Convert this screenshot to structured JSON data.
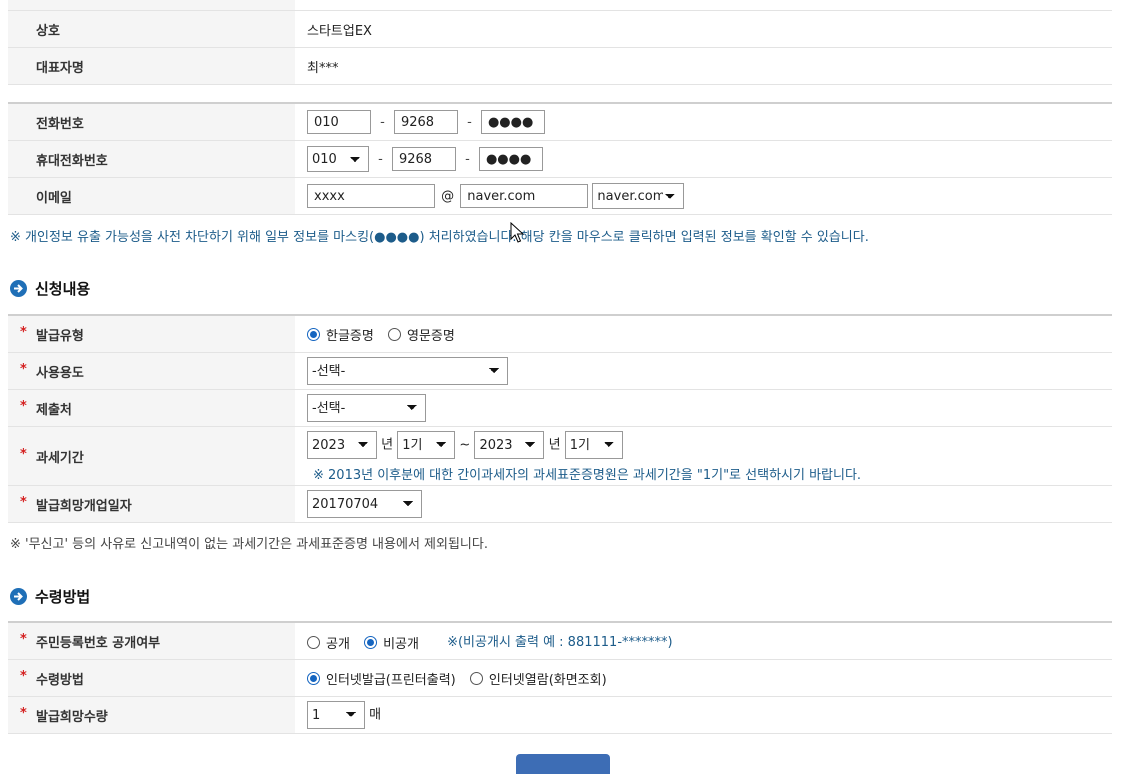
{
  "company": {
    "label": "상호",
    "value": "스타트업EX"
  },
  "ceo": {
    "label": "대표자명",
    "value": "최***"
  },
  "phone": {
    "label": "전화번호",
    "part1": "010",
    "part2": "9268",
    "part3": "●●●●"
  },
  "mobile": {
    "label": "휴대전화번호",
    "part1": "010",
    "part2": "9268",
    "part3": "●●●●"
  },
  "email": {
    "label": "이메일",
    "id": "xxxx",
    "at": "@",
    "domain": "naver.com",
    "domain_select": "naver.com"
  },
  "masking_notice": "※ 개인정보 유출 가능성을 사전 차단하기 위해 일부 정보를 마스킹(●●●●) 처리하였습니다. 해당 칸을 마우스로 클릭하면 입력된 정보를 확인할 수 있습니다.",
  "application": {
    "title": "신청내용",
    "required_mark": "*",
    "issue_type": {
      "label": "발급유형",
      "opt1": "한글증명",
      "opt2": "영문증명"
    },
    "usage": {
      "label": "사용용도",
      "value": "-선택-"
    },
    "submit_to": {
      "label": "제출처",
      "value": "-선택-"
    },
    "tax_period": {
      "label": "과세기간",
      "from_year": "2023",
      "year_unit": "년",
      "from_term": "1기",
      "tilde": "~",
      "to_year": "2023",
      "to_term": "1기",
      "note": "※ 2013년 이후분에 대한 간이과세자의 과세표준증명원은 과세기간을 \"1기\"로 선택하시기 바랍니다."
    },
    "start_date": {
      "label": "발급희망개업일자",
      "value": "20170704"
    }
  },
  "nonfiling_notice": "※ '무신고' 등의 사유로 신고내역이 없는 과세기간은 과세표준증명 내용에서 제외됩니다.",
  "receipt": {
    "title": "수령방법",
    "required_mark": "*",
    "rrn_disclosure": {
      "label": "주민등록번호 공개여부",
      "opt1": "공개",
      "opt2": "비공개",
      "hint": "※(비공개시 출력 예 : 881111-*******)"
    },
    "method": {
      "label": "수령방법",
      "opt1": "인터넷발급(프린터출력)",
      "opt2": "인터넷열람(화면조회)"
    },
    "quantity": {
      "label": "발급희망수량",
      "value": "1",
      "unit": "매"
    }
  },
  "colors": {
    "accent": "#1f6fb7",
    "required": "#d42020",
    "notice": "#1d5c8a"
  }
}
